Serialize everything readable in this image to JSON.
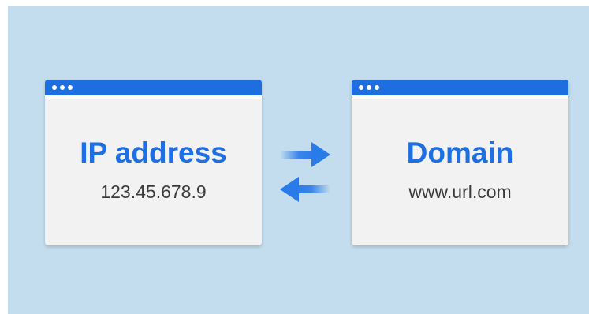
{
  "colors": {
    "background": "#c3ddee",
    "window_bar": "#1d6fe0",
    "accent_text": "#1e6fe3",
    "arrow": "#2a7bea"
  },
  "left_window": {
    "title": "IP address",
    "value": "123.45.678.9"
  },
  "right_window": {
    "title": "Domain",
    "value": "www.url.com"
  },
  "arrows": {
    "top": "arrow-right-icon",
    "bottom": "arrow-left-icon"
  }
}
